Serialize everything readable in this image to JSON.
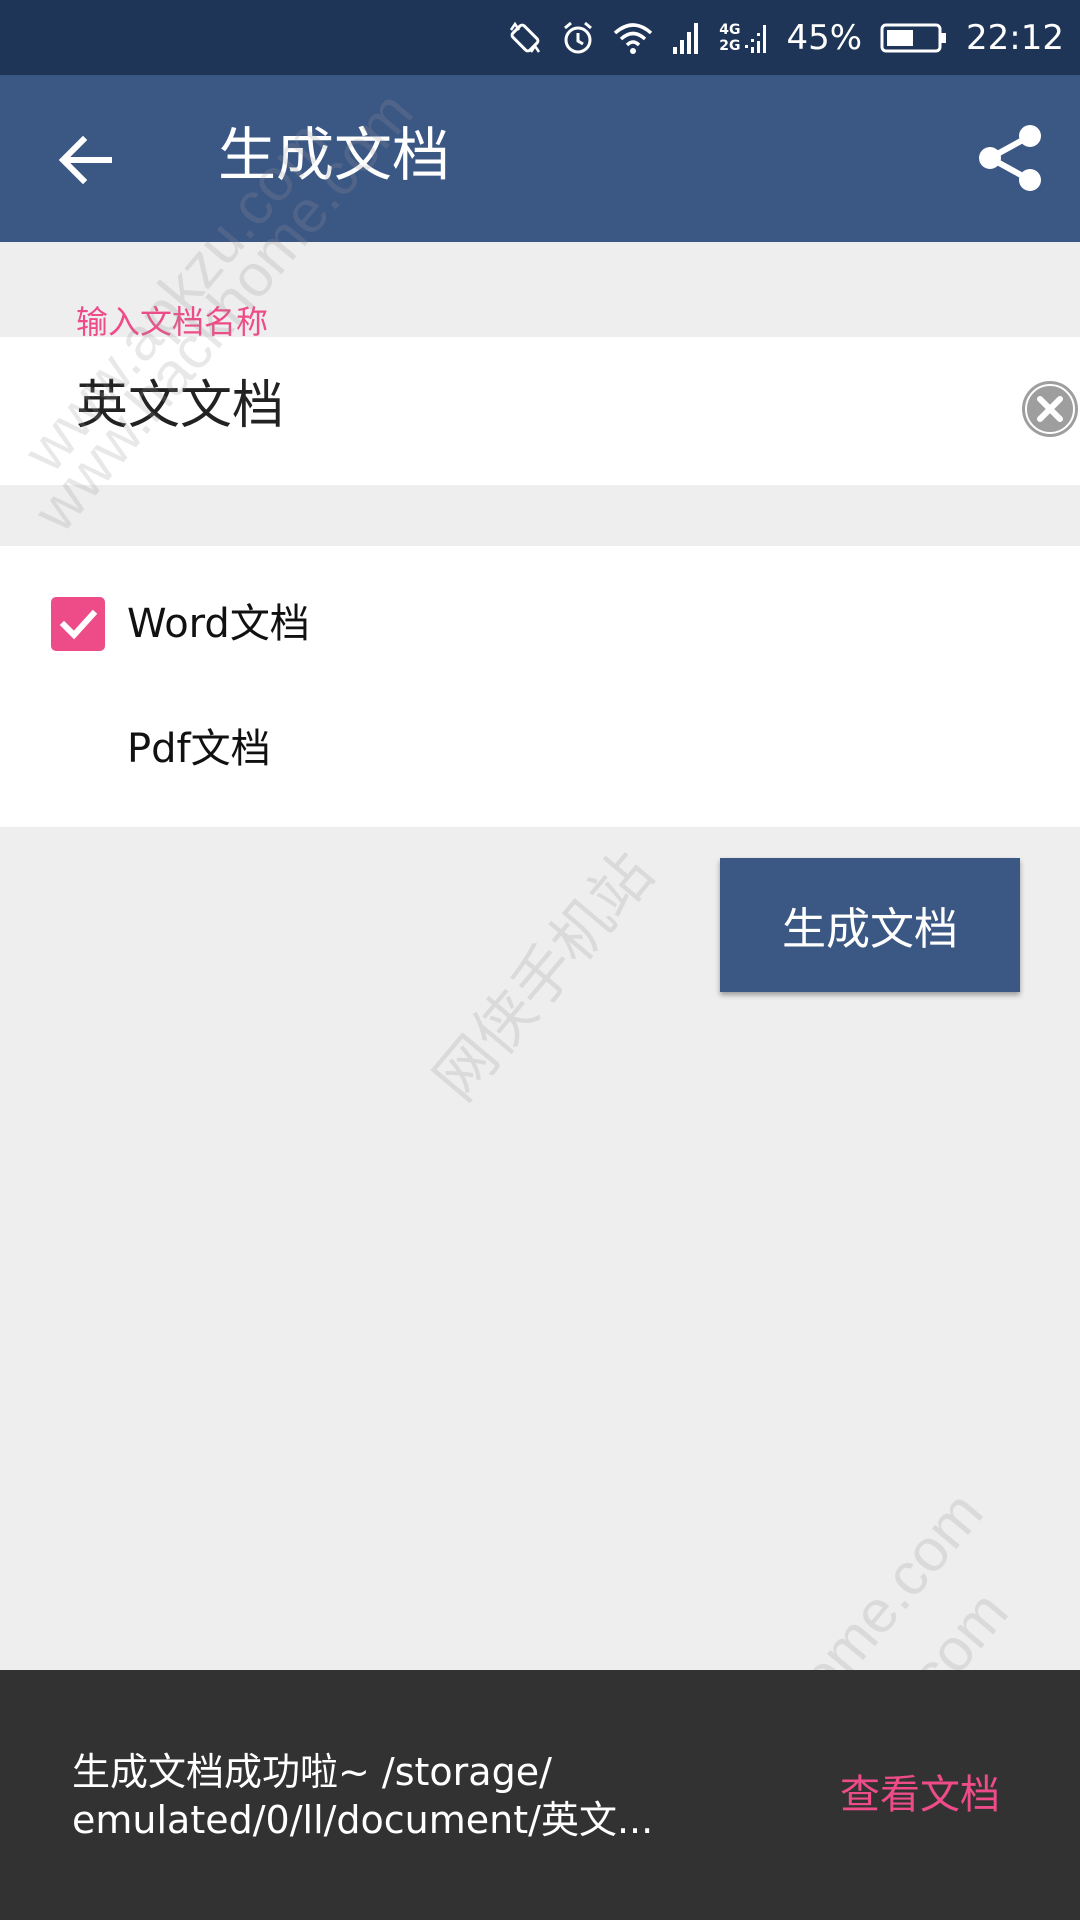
{
  "status_bar": {
    "network_top": "4G",
    "network_bottom": "2G",
    "battery_percent": "45%",
    "time": "22:12",
    "icons": [
      "rotate-icon",
      "alarm-icon",
      "wifi-icon",
      "signal-icon",
      "signal-icon-2",
      "battery-icon"
    ]
  },
  "app_bar": {
    "title": "生成文档",
    "back_icon": "arrow-left-icon",
    "share_icon": "share-icon"
  },
  "name_field": {
    "label": "输入文档名称",
    "value": "英文文档",
    "clear_icon": "clear-circle-icon"
  },
  "formats": [
    {
      "label": "Word文档",
      "checked": true
    },
    {
      "label": "Pdf文档",
      "checked": false
    }
  ],
  "generate_button": {
    "label": "生成文档"
  },
  "snackbar": {
    "message": "生成文档成功啦~  /storage/\nemulated/0/ll/document/英文...",
    "action": "查看文档"
  },
  "watermarks": [
    "www.apkzu.com",
    "www.hackhome.com",
    "网侠手机站",
    "www.hackhome.com",
    "www.apkzu.com"
  ],
  "colors": {
    "status_bar": "#1f3558",
    "app_bar": "#3b5784",
    "accent": "#ee4c88",
    "snackbar": "#323232",
    "background": "#eeeeee"
  }
}
